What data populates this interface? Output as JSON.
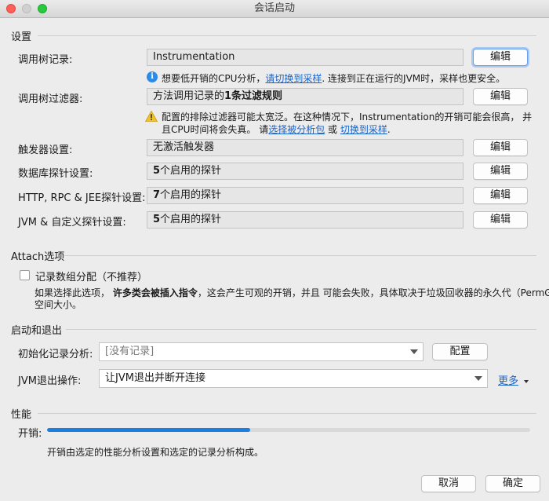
{
  "window": {
    "title": "会话启动"
  },
  "settings": {
    "section_title": "设置",
    "call_tree_recording": {
      "label": "调用树记录:",
      "value": "Instrumentation",
      "button": "编辑",
      "hint_prefix": "想要低开销的CPU分析，",
      "hint_link": "请切换到采样",
      "hint_suffix": ". 连接到正在运行的JVM时，采样也更安全。"
    },
    "call_tree_filter": {
      "label": "调用树过滤器:",
      "value_prefix": "方法调用记录的",
      "value_bold": "1条过滤规则",
      "button": "编辑",
      "warning_line1": "配置的排除过滤器可能太宽泛。在这种情况下，Instrumentation的开销可能会很高，  并",
      "warning_line2_prefix": "且CPU时间将会失真。 请",
      "warning_link1": "选择被分析包",
      "warning_middle": " 或 ",
      "warning_link2": "切换到采样",
      "warning_end": "."
    },
    "trigger": {
      "label": "触发器设置:",
      "value": "无激活触发器",
      "button": "编辑"
    },
    "db_probes": {
      "label": "数据库探针设置:",
      "value_bold": "5",
      "value_rest": "个启用的探针",
      "button": "编辑"
    },
    "http_probes": {
      "label": "HTTP, RPC & JEE探针设置:",
      "value_bold": "7",
      "value_rest": "个启用的探针",
      "button": "编辑"
    },
    "jvm_probes": {
      "label": "JVM & 自定义探针设置:",
      "value_bold": "5",
      "value_rest": "个启用的探针",
      "button": "编辑"
    }
  },
  "attach": {
    "section_title": "Attach选项",
    "record_array_alloc": {
      "label": "记录数组分配（不推荐）",
      "checked": false
    },
    "desc_prefix": "如果选择此选项， ",
    "desc_bold": "许多类会被插入指令",
    "desc_suffix": "，这会产生可观的开销，并且 可能会失败，具体取决于垃圾回收器的永久代（PermGen)",
    "desc_line2": "空间大小。"
  },
  "startup": {
    "section_title": "启动和退出",
    "initial_recording": {
      "label": "初始化记录分析:",
      "value": "[没有记录]",
      "button": "配置"
    },
    "jvm_exit": {
      "label": "JVM退出操作:",
      "value": "让JVM退出并断开连接",
      "more": "更多",
      "more_icon": "triangle-down-icon"
    }
  },
  "performance": {
    "section_title": "性能",
    "overhead_label": "开销:",
    "overhead_fraction": 0.42,
    "desc": "开销由选定的性能分析设置和选定的记录分析构成。"
  },
  "footer": {
    "cancel": "取消",
    "ok": "确定"
  },
  "colors": {
    "accent": "#1a7fe0",
    "link": "#1a64c8",
    "info": "#2a8be8",
    "warning": "#f2c12e"
  }
}
